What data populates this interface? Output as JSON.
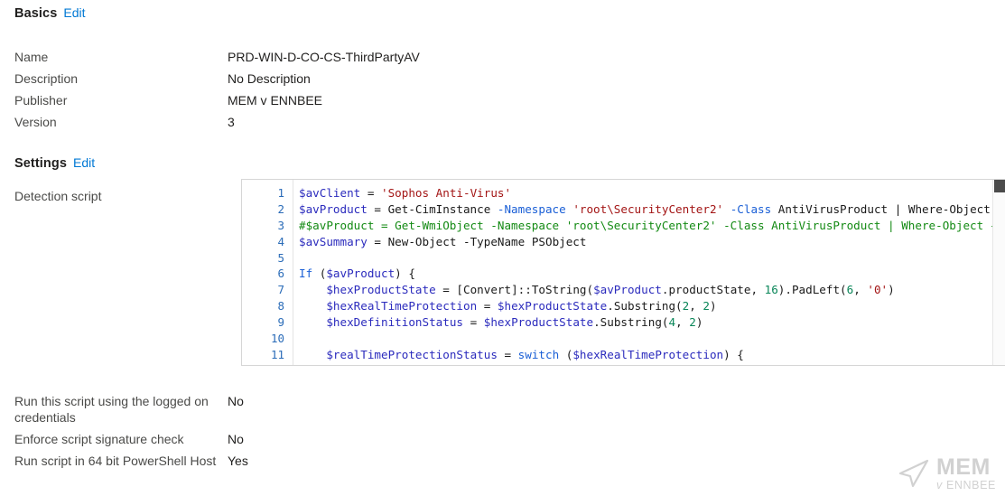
{
  "basics": {
    "title": "Basics",
    "edit_label": "Edit",
    "rows": [
      {
        "label": "Name",
        "value": "PRD-WIN-D-CO-CS-ThirdPartyAV"
      },
      {
        "label": "Description",
        "value": "No Description"
      },
      {
        "label": "Publisher",
        "value": "MEM v ENNBEE"
      },
      {
        "label": "Version",
        "value": "3"
      }
    ]
  },
  "settings": {
    "title": "Settings",
    "edit_label": "Edit",
    "detection_script_label": "Detection script",
    "rows": [
      {
        "label": "Run this script using the logged on credentials",
        "value": "No"
      },
      {
        "label": "Enforce script signature check",
        "value": "No"
      },
      {
        "label": "Run script in 64 bit PowerShell Host",
        "value": "Yes"
      }
    ]
  },
  "editor": {
    "language": "powershell",
    "line_numbers": [
      "1",
      "2",
      "3",
      "4",
      "5",
      "6",
      "7",
      "8",
      "9",
      "10",
      "11"
    ],
    "lines": [
      [
        {
          "t": "$avClient",
          "c": "var"
        },
        {
          "t": " = ",
          "c": "pln"
        },
        {
          "t": "'Sophos Anti-Virus'",
          "c": "str"
        }
      ],
      [
        {
          "t": "$avProduct",
          "c": "var"
        },
        {
          "t": " = Get-CimInstance ",
          "c": "pln"
        },
        {
          "t": "-Namespace",
          "c": "kw"
        },
        {
          "t": " ",
          "c": "pln"
        },
        {
          "t": "'root\\SecurityCenter2'",
          "c": "str"
        },
        {
          "t": " ",
          "c": "pln"
        },
        {
          "t": "-Class",
          "c": "kw"
        },
        {
          "t": " AntiVirusProduct | Where-Object { $_.d",
          "c": "pln"
        }
      ],
      [
        {
          "t": "#$avProduct = Get-WmiObject -Namespace 'root\\SecurityCenter2' -Class AntiVirusProduct | Where-Object { $_.d",
          "c": "cmt"
        }
      ],
      [
        {
          "t": "$avSummary",
          "c": "var"
        },
        {
          "t": " = New-Object ",
          "c": "pln"
        },
        {
          "t": "-TypeName",
          "c": "pln"
        },
        {
          "t": " PSObject",
          "c": "pln"
        }
      ],
      [],
      [
        {
          "t": "If",
          "c": "kw"
        },
        {
          "t": " (",
          "c": "pln"
        },
        {
          "t": "$avProduct",
          "c": "var"
        },
        {
          "t": ") {",
          "c": "pln"
        }
      ],
      [
        {
          "t": "    ",
          "c": "pln"
        },
        {
          "t": "$hexProductState",
          "c": "var"
        },
        {
          "t": " = [Convert]::ToString(",
          "c": "pln"
        },
        {
          "t": "$avProduct",
          "c": "var"
        },
        {
          "t": ".productState, ",
          "c": "pln"
        },
        {
          "t": "16",
          "c": "num"
        },
        {
          "t": ").PadLeft(",
          "c": "pln"
        },
        {
          "t": "6",
          "c": "num"
        },
        {
          "t": ", ",
          "c": "pln"
        },
        {
          "t": "'0'",
          "c": "str"
        },
        {
          "t": ")",
          "c": "pln"
        }
      ],
      [
        {
          "t": "    ",
          "c": "pln"
        },
        {
          "t": "$hexRealTimeProtection",
          "c": "var"
        },
        {
          "t": " = ",
          "c": "pln"
        },
        {
          "t": "$hexProductState",
          "c": "var"
        },
        {
          "t": ".Substring(",
          "c": "pln"
        },
        {
          "t": "2",
          "c": "num"
        },
        {
          "t": ", ",
          "c": "pln"
        },
        {
          "t": "2",
          "c": "num"
        },
        {
          "t": ")",
          "c": "pln"
        }
      ],
      [
        {
          "t": "    ",
          "c": "pln"
        },
        {
          "t": "$hexDefinitionStatus",
          "c": "var"
        },
        {
          "t": " = ",
          "c": "pln"
        },
        {
          "t": "$hexProductState",
          "c": "var"
        },
        {
          "t": ".Substring(",
          "c": "pln"
        },
        {
          "t": "4",
          "c": "num"
        },
        {
          "t": ", ",
          "c": "pln"
        },
        {
          "t": "2",
          "c": "num"
        },
        {
          "t": ")",
          "c": "pln"
        }
      ],
      [],
      [
        {
          "t": "    ",
          "c": "pln"
        },
        {
          "t": "$realTimeProtectionStatus",
          "c": "var"
        },
        {
          "t": " = ",
          "c": "pln"
        },
        {
          "t": "switch",
          "c": "kw"
        },
        {
          "t": " (",
          "c": "pln"
        },
        {
          "t": "$hexRealTimeProtection",
          "c": "var"
        },
        {
          "t": ") {",
          "c": "pln"
        }
      ]
    ]
  },
  "watermark": {
    "primary": "MEM",
    "secondary_italic": "v",
    "secondary": "ENNBEE"
  },
  "colors": {
    "link": "#0078d4",
    "label": "#4a4a48",
    "value": "#201f1e",
    "code_variable": "#2b2bbd",
    "code_string": "#a31515",
    "code_comment": "#138a13",
    "code_keyword": "#1a5fd6",
    "code_number": "#098658",
    "editor_border": "#d6d6d6",
    "gutter_number": "#2b6cb8",
    "watermark": "#c9c9c9"
  }
}
